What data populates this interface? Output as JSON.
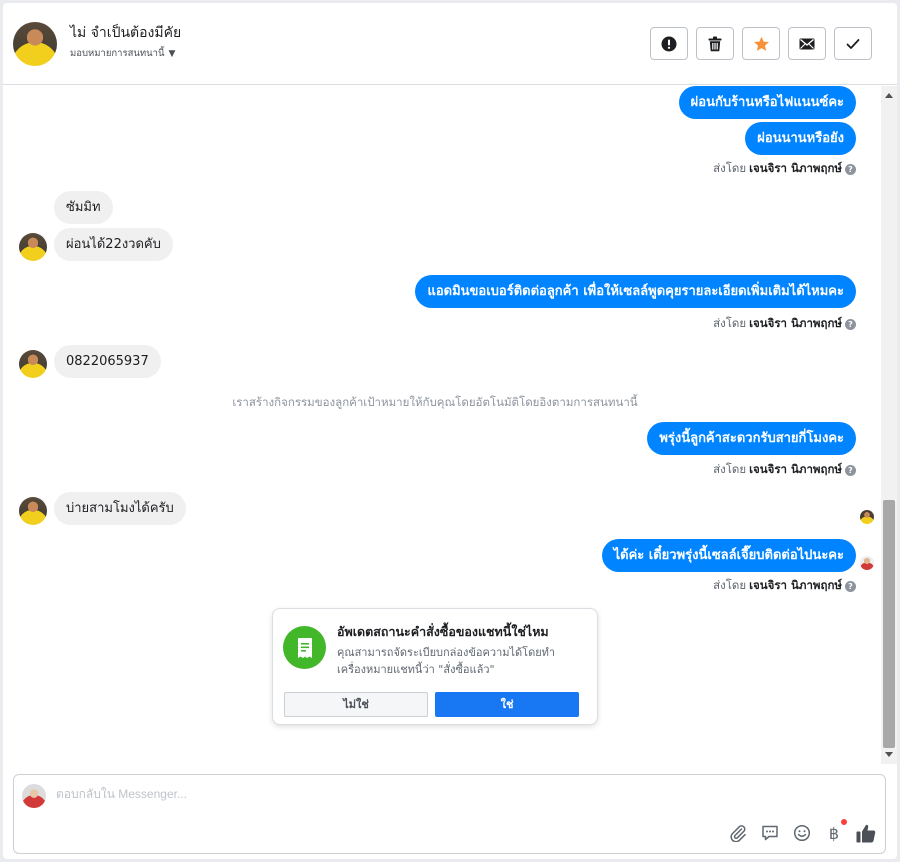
{
  "header": {
    "name": "ไม่ จำเป็นต้องมีคัย",
    "assign_label": "มอบหมายการสนทนานี้",
    "actions": [
      {
        "name": "report-button",
        "icon": "exclamation-icon"
      },
      {
        "name": "delete-button",
        "icon": "trash-icon"
      },
      {
        "name": "star-button",
        "icon": "star-icon"
      },
      {
        "name": "mark-unread-button",
        "icon": "envelope-icon"
      },
      {
        "name": "mark-done-button",
        "icon": "checkmark-icon"
      }
    ]
  },
  "messages": [
    {
      "id": "m1",
      "dir": "out",
      "text": "ผ่อนกับร้านหรือไฟแนนซ์คะ"
    },
    {
      "id": "m2",
      "dir": "out",
      "text": "ผ่อนนานหรือยัง"
    },
    {
      "id": "m3",
      "dir": "in",
      "text": "ซัมมิท"
    },
    {
      "id": "m4",
      "dir": "in",
      "text": "ผ่อนได้22งวดคับ"
    },
    {
      "id": "m5",
      "dir": "out",
      "text": "แอดมินขอเบอร์ติดต่อลูกค้า เพื่อให้เซลล์พูดคุยรายละเอียดเพิ่มเติมได้ไหมคะ"
    },
    {
      "id": "m6",
      "dir": "in",
      "text": "0822065937"
    },
    {
      "id": "m7",
      "dir": "out",
      "text": "พรุ่งนี้ลูกค้าสะดวกรับสายกี่โมงคะ"
    },
    {
      "id": "m8",
      "dir": "in",
      "text": "บ่ายสามโมงได้ครับ"
    },
    {
      "id": "m9",
      "dir": "out",
      "text": "ได้ค่ะ เดี๋ยวพรุ่งนี้เซลล์เจี๊ยบติดต่อไปนะคะ"
    }
  ],
  "sent_by": {
    "prefix": "ส่งโดย",
    "agent": "เจนจิรา นิภาพฤกษ์",
    "help": "?"
  },
  "system_note": "เราสร้างกิจกรรมของลูกค้าเป้าหมายให้กับคุณโดยอัตโนมัติโดยอิงตามการสนทนานี้",
  "order_card": {
    "title": "อัพเดตสถานะคำสั่งซื้อของแชทนี้ใช่ไหม",
    "description": "คุณสามารถจัดระเบียบกล่องข้อความได้โดยทำเครื่องหมายแชทนี้ว่า \"สั่งซื้อแล้ว\"",
    "no_label": "ไม่ใช่",
    "yes_label": "ใช่",
    "icon": "receipt-icon"
  },
  "composer": {
    "placeholder": "ตอบกลับใน Messenger...",
    "tools": [
      "attachment-icon",
      "saved-replies-icon",
      "emoji-icon",
      "baht-payment-icon",
      "like-icon"
    ],
    "baht_symbol": "฿"
  },
  "colors": {
    "outgoing_bubble": "#0084ff",
    "incoming_bubble": "#f1f0f0",
    "accent_star": "#f7923b",
    "yes_button": "#1877f2",
    "order_icon_bg": "#42b72a"
  }
}
